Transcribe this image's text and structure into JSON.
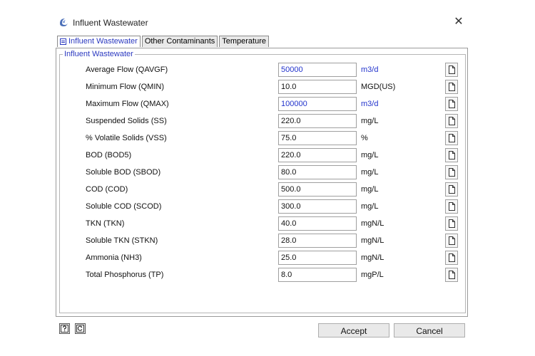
{
  "window": {
    "title": "Influent Wastewater",
    "close_glyph": "✕"
  },
  "tabs": [
    {
      "label": "Influent Wastewater",
      "active": true
    },
    {
      "label": "Other Contaminants",
      "active": false
    },
    {
      "label": "Temperature",
      "active": false
    }
  ],
  "group": {
    "title": "Influent Wastewater"
  },
  "rows": [
    {
      "label": "Average Flow (QAVGF)",
      "value": "50000",
      "unit": "m3/d"
    },
    {
      "label": "Minimum Flow (QMIN)",
      "value": "10.0",
      "unit": "MGD(US)"
    },
    {
      "label": "Maximum Flow (QMAX)",
      "value": "100000",
      "unit": "m3/d"
    },
    {
      "label": "Suspended Solids (SS)",
      "value": "220.0",
      "unit": "mg/L"
    },
    {
      "label": "% Volatile Solids (VSS)",
      "value": "75.0",
      "unit": "%"
    },
    {
      "label": "BOD (BOD5)",
      "value": "220.0",
      "unit": "mg/L"
    },
    {
      "label": "Soluble BOD (SBOD)",
      "value": "80.0",
      "unit": "mg/L"
    },
    {
      "label": "COD (COD)",
      "value": "500.0",
      "unit": "mg/L"
    },
    {
      "label": "Soluble COD (SCOD)",
      "value": "300.0",
      "unit": "mg/L"
    },
    {
      "label": "TKN (TKN)",
      "value": "40.0",
      "unit": "mgN/L"
    },
    {
      "label": "Soluble TKN (STKN)",
      "value": "28.0",
      "unit": "mgN/L"
    },
    {
      "label": "Ammonia (NH3)",
      "value": "25.0",
      "unit": "mgN/L"
    },
    {
      "label": "Total Phosphorus (TP)",
      "value": "8.0",
      "unit": "mgP/L"
    }
  ],
  "buttons": {
    "accept": "Accept",
    "cancel": "Cancel"
  },
  "colors": {
    "accent": "#2b39c0",
    "highlight_value": "#2233cc"
  }
}
